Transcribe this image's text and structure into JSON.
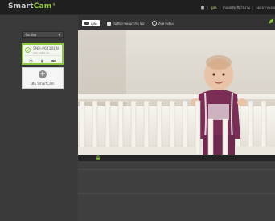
{
  "header": {
    "logo_text": "Smart",
    "logo_accent": "Cam",
    "logo_mark": "®",
    "nav": [
      "ดูสด",
      "อัปเดตบัญชีผู้ใช้งาน",
      "ออกจากระบบ"
    ],
    "nav_active_index": 0
  },
  "sidebar": {
    "dropdown_value": "ชื่อกล้อง",
    "camera": {
      "name": "SNH-P6410BN",
      "subtitle": "192.168.0.10"
    },
    "add_label": "เพิ่ม SmartCam"
  },
  "tabs": {
    "live": "ดูสด",
    "tab2": "บันทึกภาพบนการ์ด SD",
    "tab3": "ตั้งค่ากล้อง"
  },
  "colors": {
    "accent": "#8dc63f",
    "background": "#3b3b3b",
    "topbar": "#1f1f1f",
    "control_bar": "#242424"
  },
  "icons": [
    "home-icon",
    "check-icon",
    "gear-icon",
    "delete-icon",
    "video-icon",
    "plus-icon",
    "camera-icon",
    "lock-icon",
    "settings-icon",
    "leaf-icon"
  ]
}
